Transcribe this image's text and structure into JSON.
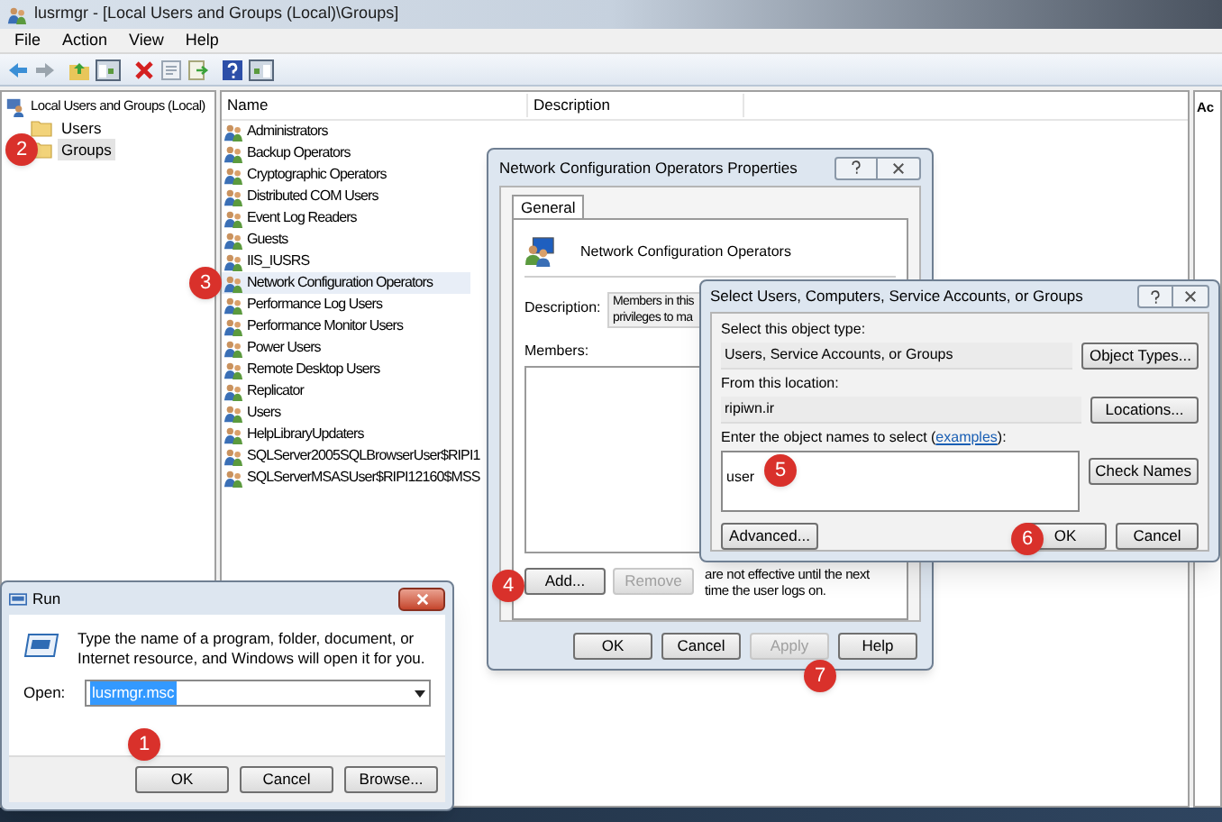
{
  "main_window": {
    "title": "lusrmgr - [Local Users and Groups (Local)\\Groups]",
    "menu": [
      "File",
      "Action",
      "View",
      "Help"
    ],
    "tree": {
      "label": "Local Users and Groups (Local)",
      "children": [
        {
          "label": "Users",
          "selected": false
        },
        {
          "label": "Groups",
          "selected": true
        }
      ]
    },
    "columns": [
      "Name",
      "Description"
    ],
    "groups": [
      {
        "name": "Administrators",
        "selected": false
      },
      {
        "name": "Backup Operators",
        "selected": false
      },
      {
        "name": "Cryptographic Operators",
        "selected": false
      },
      {
        "name": "Distributed COM Users",
        "selected": false
      },
      {
        "name": "Event Log Readers",
        "selected": false
      },
      {
        "name": "Guests",
        "selected": false
      },
      {
        "name": "IIS_IUSRS",
        "selected": false
      },
      {
        "name": "Network Configuration Operators",
        "selected": true
      },
      {
        "name": "Performance Log Users",
        "selected": false
      },
      {
        "name": "Performance Monitor Users",
        "selected": false
      },
      {
        "name": "Power Users",
        "selected": false
      },
      {
        "name": "Remote Desktop Users",
        "selected": false
      },
      {
        "name": "Replicator",
        "selected": false
      },
      {
        "name": "Users",
        "selected": false
      },
      {
        "name": "HelpLibraryUpdaters",
        "selected": false
      },
      {
        "name": "SQLServer2005SQLBrowserUser$RIPI1",
        "selected": false
      },
      {
        "name": "SQLServerMSASUser$RIPI12160$MSS",
        "selected": false
      }
    ],
    "action_pane": {
      "title": "Ac"
    }
  },
  "properties_dialog": {
    "title": "Network Configuration Operators Properties",
    "tabs": [
      {
        "label": "General",
        "selected": true
      }
    ],
    "group_name": "Network Configuration Operators",
    "description_label": "Description:",
    "description_lines": [
      "Members in this",
      "privileges to ma"
    ],
    "members_label": "Members:",
    "member_buttons": [
      {
        "label": "Add...",
        "disabled": false
      },
      {
        "label": "Remove",
        "disabled": true
      }
    ],
    "note": "are not effective until the next time the user logs on.",
    "buttons": [
      {
        "label": "OK",
        "disabled": false
      },
      {
        "label": "Cancel",
        "disabled": false
      },
      {
        "label": "Apply",
        "disabled": true
      },
      {
        "label": "Help",
        "disabled": false
      }
    ]
  },
  "select_dialog": {
    "title": "Select Users, Computers, Service Accounts, or Groups",
    "object_type_label": "Select this object type:",
    "object_type": "Users, Service Accounts, or Groups",
    "object_types_button": "Object Types...",
    "location_label": "From this location:",
    "location": "ripiwn.ir",
    "locations_button": "Locations...",
    "names_label": "Enter the object names to select (",
    "names_link": "examples",
    "names_label_end": "):",
    "names_value": "user",
    "check_names_button": "Check Names",
    "advanced_button": "Advanced...",
    "buttons": [
      "OK",
      "Cancel"
    ]
  },
  "run_dialog": {
    "title": "Run",
    "prompt": "Type the name of a program, folder, document, or Internet resource, and Windows will open it for you.",
    "open_label": "Open:",
    "open_value": "lusrmgr.msc",
    "value_selected": true,
    "buttons": [
      "OK",
      "Cancel",
      "Browse..."
    ]
  },
  "step_markers": [
    "1",
    "2",
    "3",
    "4",
    "5",
    "6",
    "7"
  ]
}
